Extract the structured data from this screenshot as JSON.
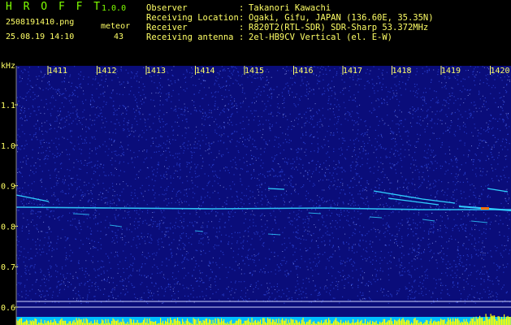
{
  "header": {
    "app_name": "H R O F F T",
    "app_version": "1.0.0",
    "file_name": "2508191410.png",
    "datetime": "25.08.19 14:10",
    "meteor_label": "meteor",
    "meteor_count": "43",
    "info": [
      {
        "label": "Observer",
        "value": "Takanori Kawachi"
      },
      {
        "label": "Receiving Location",
        "value": "Ogaki, Gifu, JAPAN (136.60E, 35.35N)"
      },
      {
        "label": "Receiver",
        "value": "R820T2(RTL-SDR) SDR-Sharp 53.372MHz"
      },
      {
        "label": "Receiving antenna",
        "value": "2el-HB9CV Vertical (el. E-W)"
      }
    ],
    "separator": ":"
  },
  "spectrogram": {
    "y_unit": "kHz",
    "y_ticks": [
      "1.1",
      "1.0",
      "0.9",
      "0.8",
      "0.7",
      "0.6"
    ],
    "time_ticks": [
      "1411",
      "1412",
      "1413",
      "1414",
      "1415",
      "1416",
      "1417",
      "1418",
      "1419",
      "1420"
    ],
    "colors": {
      "background": "#0a0d7a",
      "noise": "#3a5cff",
      "trace": "#30d0ff",
      "hot": "#ff7000",
      "baseline": "#ffff00",
      "labels": "#ffff66"
    }
  }
}
